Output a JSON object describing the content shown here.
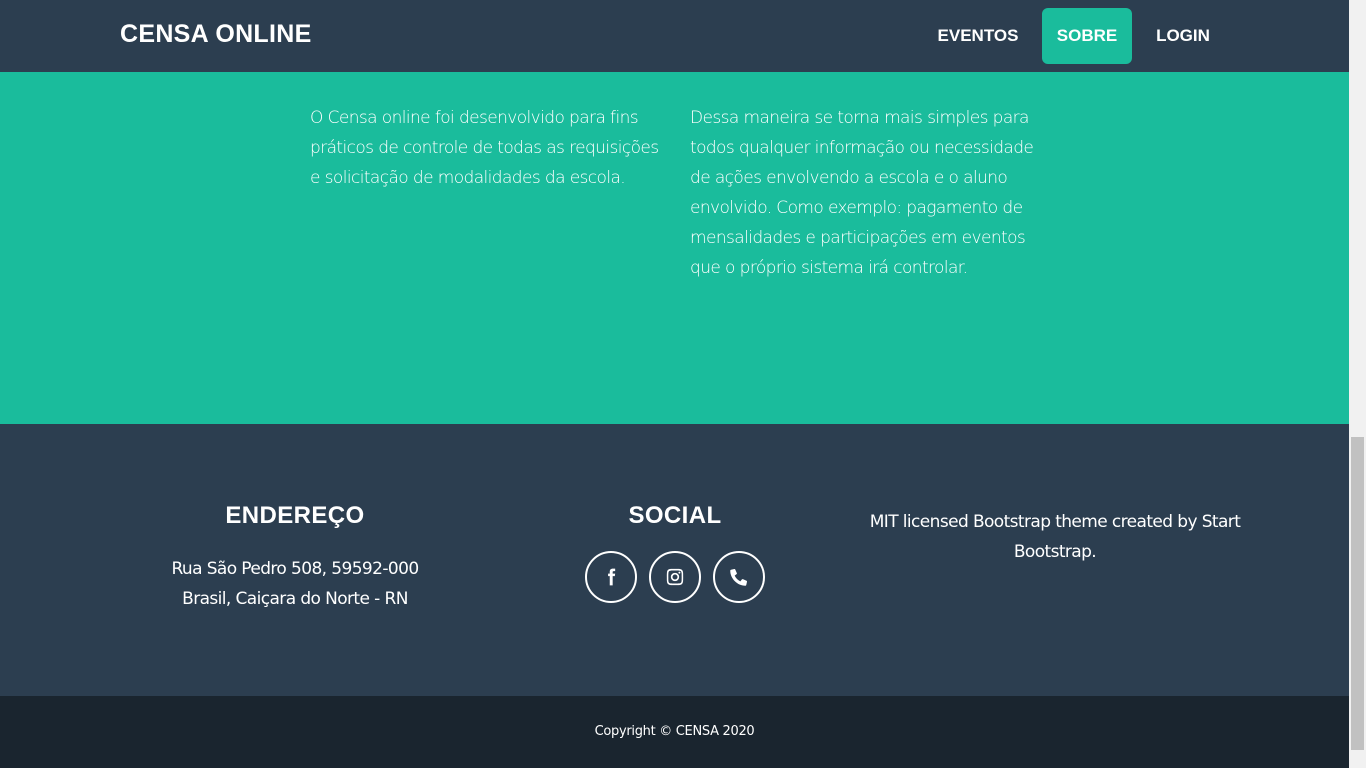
{
  "navbar": {
    "brand": "CENSA ONLINE",
    "items": [
      {
        "label": "EVENTOS"
      },
      {
        "label": "SOBRE",
        "active": true
      },
      {
        "label": "LOGIN"
      }
    ]
  },
  "about": {
    "left_text": "O Censa online foi desenvolvido para fins práticos de controle de todas as requisições e solicitação de modalidades da escola.",
    "right_text": "Dessa maneira se torna mais simples para todos qualquer informação ou necessidade de ações envolvendo a escola e o aluno envolvido. Como exemplo: pagamento de mensalidades e participações em eventos que o próprio sistema irá controlar."
  },
  "footer": {
    "address": {
      "heading": "ENDEREÇO",
      "line1": "Rua São Pedro 508, 59592-000",
      "line2": "Brasil, Caiçara do Norte - RN"
    },
    "social": {
      "heading": "SOCIAL",
      "icons": [
        "facebook-icon",
        "instagram-icon",
        "phone-icon"
      ]
    },
    "about": {
      "text": "MIT licensed Bootstrap theme created by Start Bootstrap."
    }
  },
  "copyright": {
    "text": "Copyright © CENSA 2020"
  },
  "colors": {
    "navbar": "#2c3e50",
    "accent": "#1abc9c",
    "footer": "#2c3e50",
    "copyright": "#1a252f"
  }
}
